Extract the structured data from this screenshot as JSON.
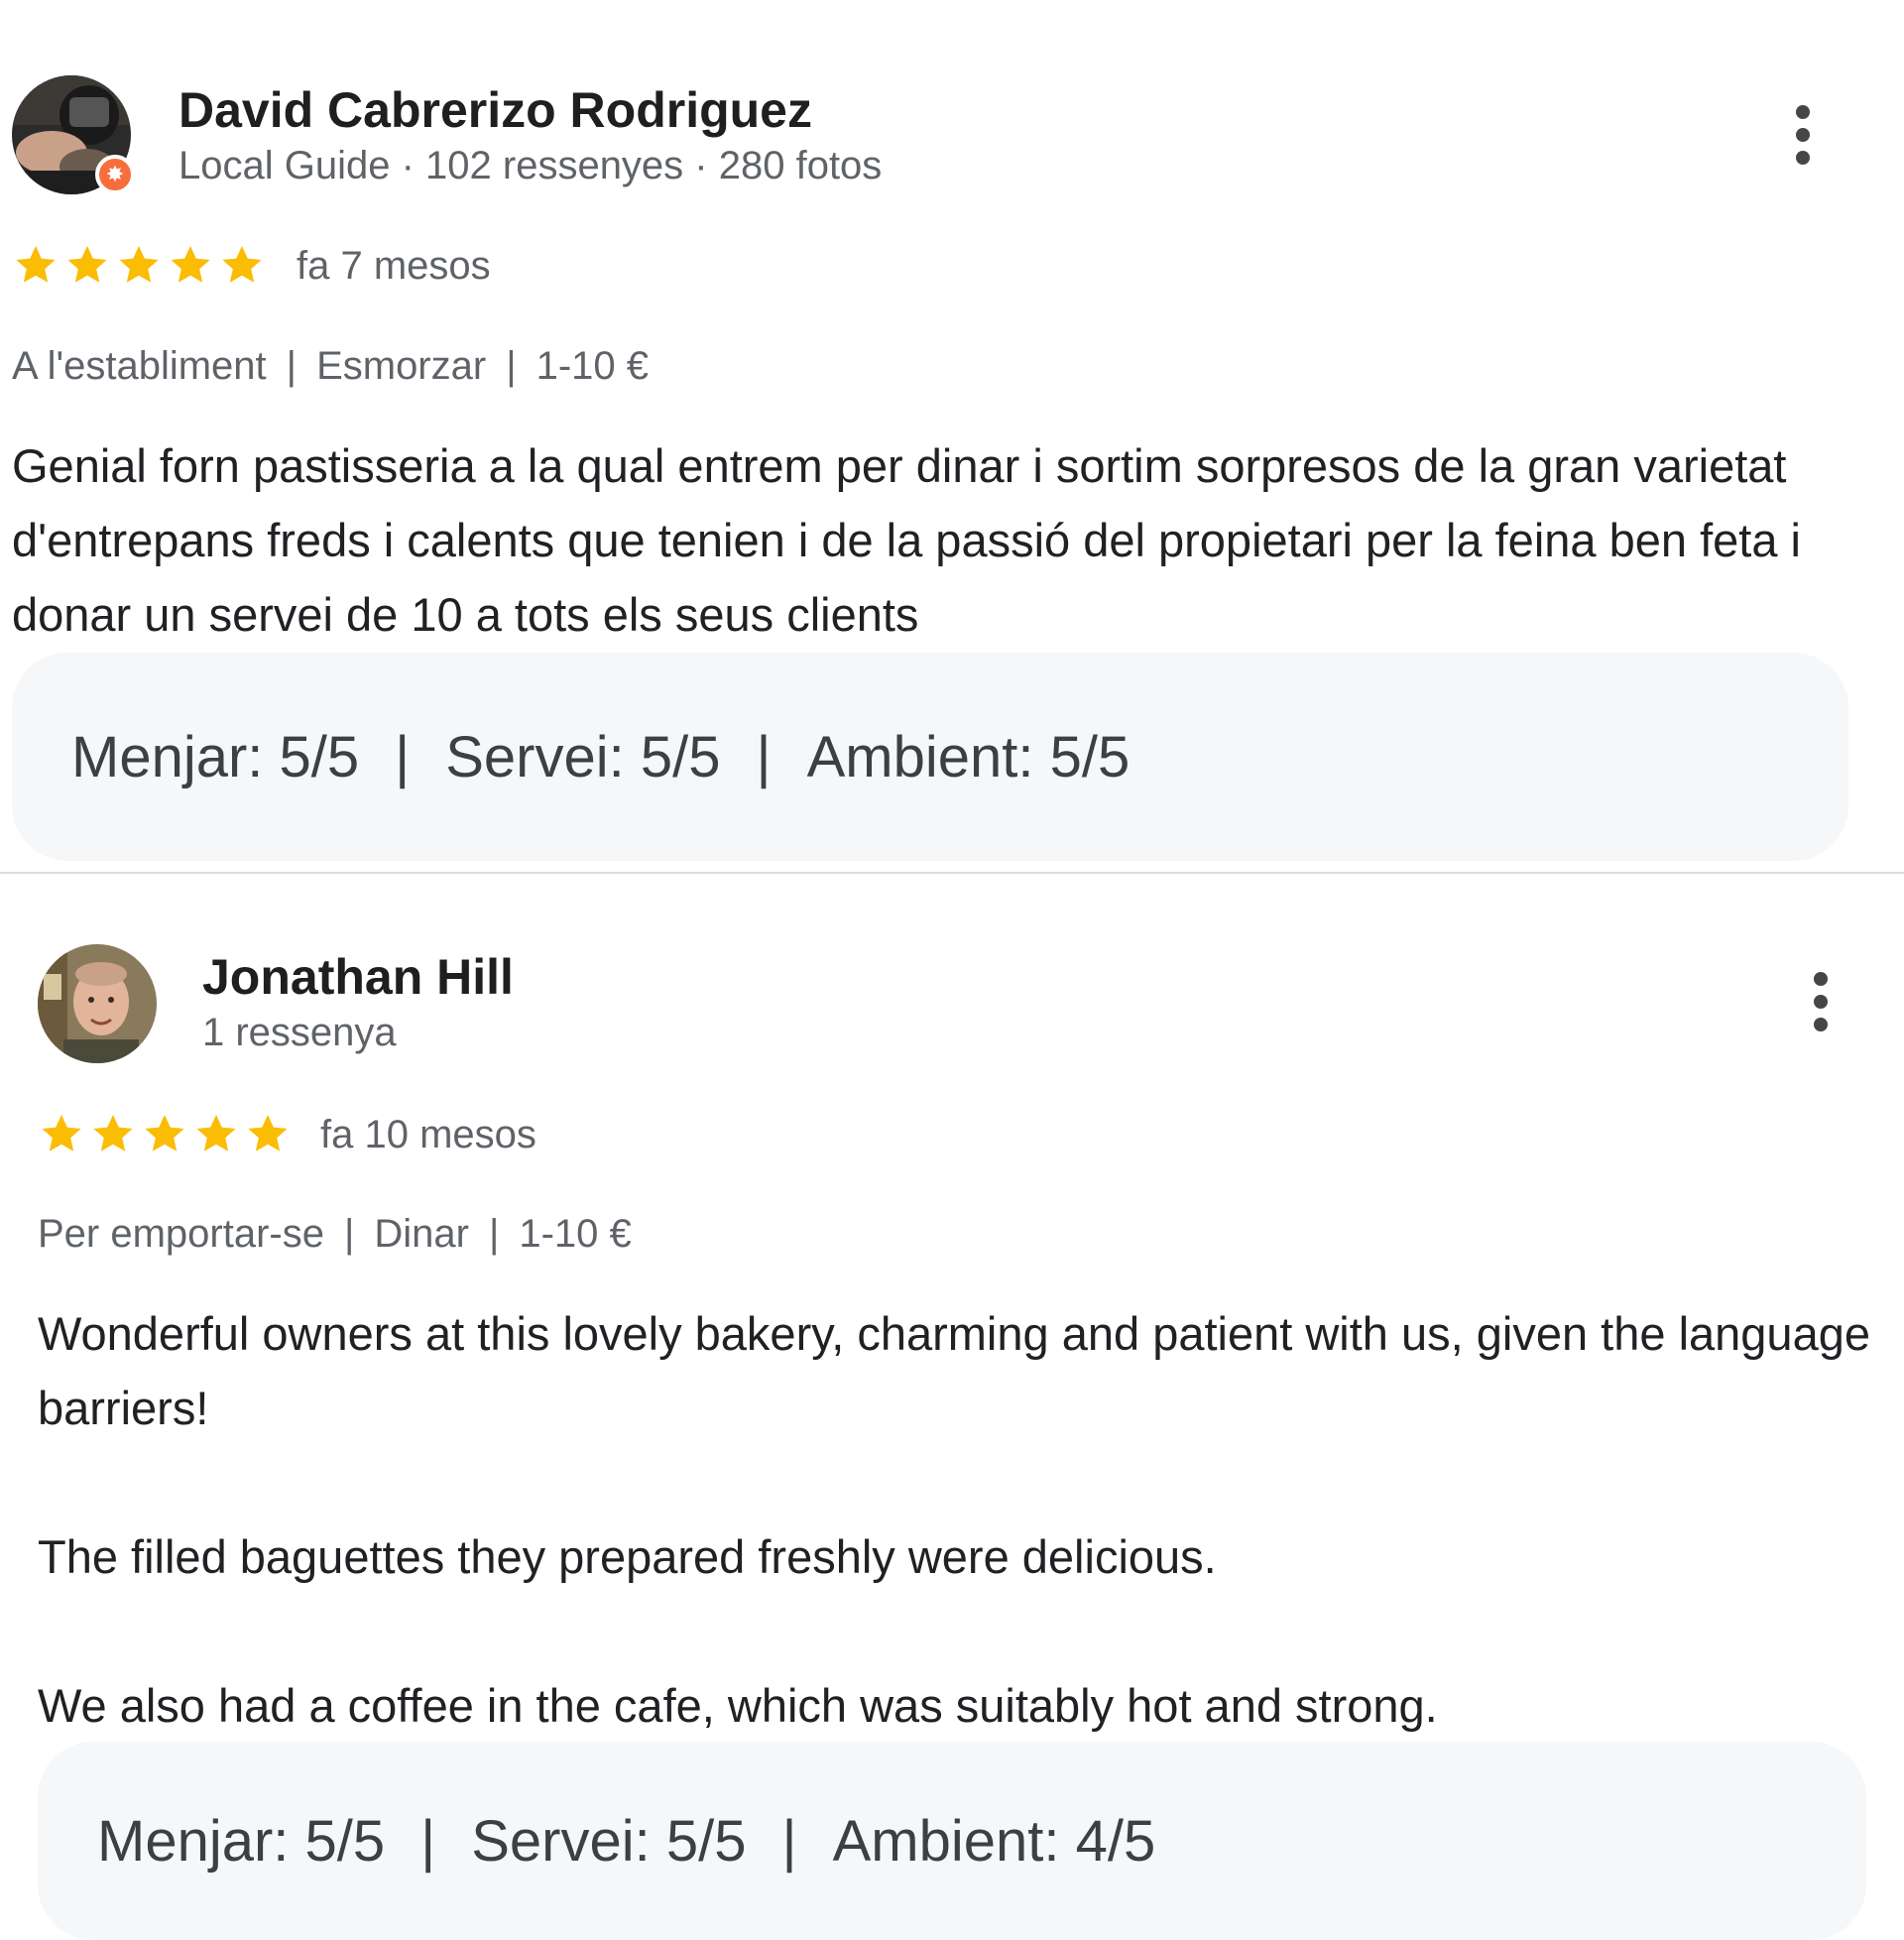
{
  "reviews": [
    {
      "author": "David Cabrerizo Rodriguez",
      "meta": "Local Guide · 102 ressenyes · 280 fotos",
      "is_local_guide": true,
      "rating": 5,
      "time": "fa 7 mesos",
      "tags": [
        "A l'establiment",
        "Esmorzar",
        "1-10 €"
      ],
      "paragraphs": [
        "Genial forn pastisseria a la qual entrem per dinar i sortim sorpresos de la gran varietat d'entrepans freds i calents que tenien i de la passió del propietari per la feina ben feta i donar un servei de 10 a tots els seus clients"
      ],
      "ratings": [
        {
          "label": "Menjar: 5/5"
        },
        {
          "label": "Servei: 5/5"
        },
        {
          "label": "Ambient: 5/5"
        }
      ]
    },
    {
      "author": "Jonathan Hill",
      "meta": "1 ressenya",
      "is_local_guide": false,
      "rating": 5,
      "time": "fa 10 mesos",
      "tags": [
        "Per emportar-se",
        "Dinar",
        "1-10 €"
      ],
      "paragraphs": [
        "Wonderful owners at this lovely bakery, charming and patient with us, given the language barriers!",
        "The filled baguettes they prepared freshly were delicious.",
        "We also had a coffee in the cafe, which was suitably hot and strong."
      ],
      "ratings": [
        {
          "label": "Menjar: 5/5"
        },
        {
          "label": "Servei: 5/5"
        },
        {
          "label": "Ambient: 4/5"
        }
      ]
    }
  ],
  "separator": "|",
  "icons": {
    "star": "star-icon",
    "more": "more-vert-icon",
    "badge": "local-guide-badge-icon"
  },
  "colors": {
    "star": "#fbbc04",
    "badge": "#f76d3c",
    "ratings_bg": "#f5f7f9",
    "divider": "#dadce0"
  }
}
